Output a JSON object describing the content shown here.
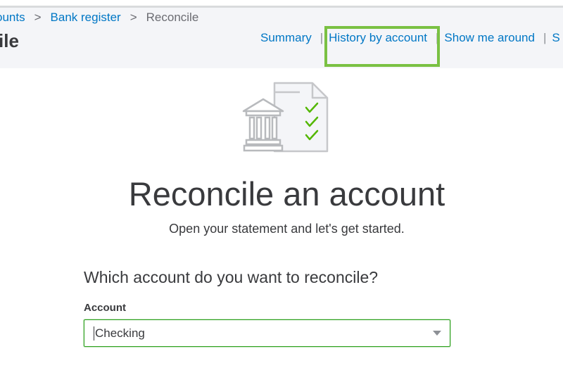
{
  "breadcrumb": {
    "items": [
      "ounts",
      "Bank register"
    ],
    "current": "Reconcile",
    "separator": ">"
  },
  "header": {
    "title": "ile",
    "links": [
      "Summary",
      "History by account",
      "Show me around",
      "S"
    ],
    "highlight_color": "#7ac143"
  },
  "illustration": {
    "icon": "bank-statement-checklist-icon"
  },
  "main": {
    "heading": "Reconcile an account",
    "subheading": "Open your statement and let's get started.",
    "question": "Which account do you want to reconcile?"
  },
  "account_field": {
    "label": "Account",
    "value": "Checking"
  },
  "colors": {
    "link": "#0077c5",
    "text": "#393a3d",
    "header_bg": "#f4f5f8",
    "check": "#53b700",
    "focus_border": "#2ca01c"
  }
}
